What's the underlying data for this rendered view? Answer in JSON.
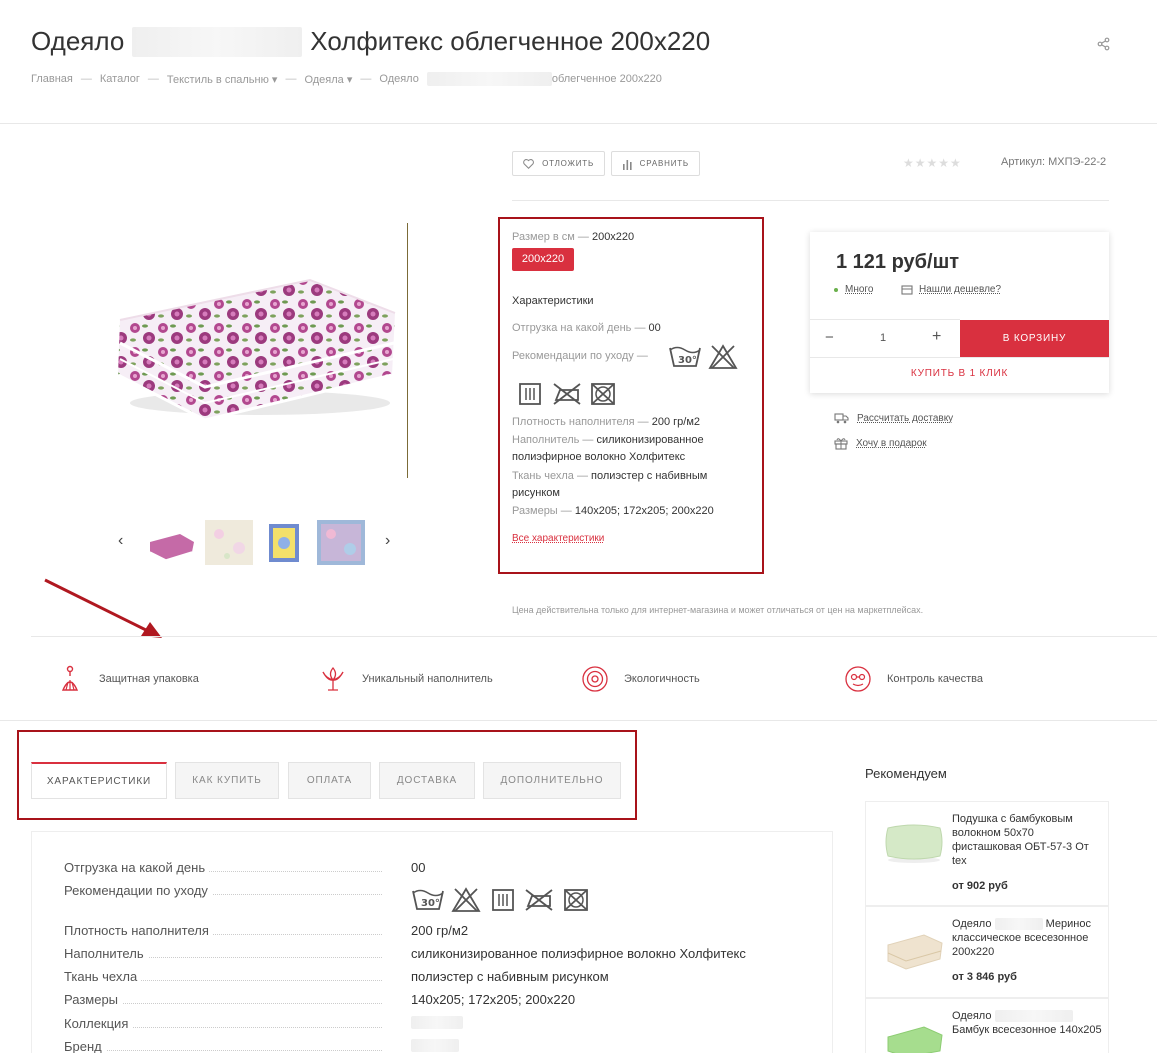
{
  "header": {
    "title_start": "Одеяло",
    "title_end": "Холфитекс облегченное 200х220",
    "breadcrumbs": [
      "Главная",
      "Каталог",
      "Текстиль в спальню",
      "Одеяла",
      "Одеяло",
      "облегченное 200х220"
    ]
  },
  "actions": {
    "defer": "отложить",
    "compare": "сравнить"
  },
  "rating": {
    "stars": "★★★★★",
    "value": 0
  },
  "sku": "Артикул: МХПЭ-22-2",
  "props": {
    "size_label": "Размер в см",
    "size_value": "200х220",
    "size_chip": "200х220",
    "section": "Характеристики",
    "shipment_label": "Отгрузка на какой день",
    "shipment_value": "00",
    "care_label": "Рекомендации по уходу",
    "wash_temp": "30°",
    "density_label": "Плотность наполнителя",
    "density_value": "200 гр/м2",
    "filler_label": "Наполнитель",
    "filler_value_1": "силиконизированное",
    "filler_value_2": "полиэфирное волокно Холфитекс",
    "fabric_label": "Ткань чехла",
    "fabric_value_1": "полиэстер с набивным",
    "fabric_value_2": "рисунком",
    "sizes_label": "Размеры",
    "sizes_value": "140х205; 172х205; 200х220",
    "all_link": "Все характеристики"
  },
  "buy": {
    "price": "1 121 руб/шт",
    "stock": "Много",
    "cheaper": "Нашли дешевле?",
    "qty": "1",
    "minus": "−",
    "plus": "+",
    "to_cart": "В КОРЗИНУ",
    "one_click": "КУПИТЬ В 1 КЛИК",
    "delivery": "Рассчитать доставку",
    "gift": "Хочу в подарок"
  },
  "price_note": "Цена действительна только для интернет-магазина и может отличаться от цен на маркетплейсах.",
  "features": [
    "Защитная упаковка",
    "Уникальный наполнитель",
    "Экологичность",
    "Контроль качества"
  ],
  "tabs": [
    "Характеристики",
    "Как купить",
    "Оплата",
    "Доставка",
    "Дополнительно"
  ],
  "specs": {
    "shipment": {
      "k": "Отгрузка на какой день",
      "v": "00"
    },
    "care": {
      "k": "Рекомендации по уходу"
    },
    "density": {
      "k": "Плотность наполнителя",
      "v": "200 гр/м2"
    },
    "filler": {
      "k": "Наполнитель",
      "v": "силиконизированное полиэфирное волокно Холфитекс"
    },
    "fabric": {
      "k": "Ткань чехла",
      "v": "полиэстер с набивным рисунком"
    },
    "sizes": {
      "k": "Размеры",
      "v": "140х205; 172х205; 200х220"
    },
    "collection": {
      "k": "Коллекция"
    },
    "brand": {
      "k": "Бренд"
    }
  },
  "recommend": {
    "title": "Рекомендуем",
    "items": [
      {
        "name": "Подушка с бамбуковым волокном 50х70 фисташковая ОБТ-57-3 От tex",
        "price": "от 902 руб"
      },
      {
        "name_a": "Одеяло",
        "name_b": "Меринос классическое всесезонное 200х220",
        "price": "от 3 846 руб"
      },
      {
        "name_a": "Одеяло",
        "name_b": "Бамбук всесезонное 140х205",
        "price": ""
      }
    ]
  },
  "colors": {
    "accent": "#d9303f",
    "highlight_box": "#a8131a",
    "stock_dot": "#6ab04c"
  }
}
